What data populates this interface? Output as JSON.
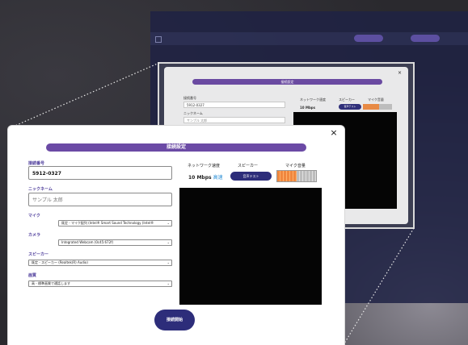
{
  "zoom_dialog": {
    "title": "接続設定",
    "close": "×",
    "field1_label": "接続番号",
    "field1_value": "5912-0327",
    "field2_label": "ニックネーム",
    "field2_value": "サンプル 太郎",
    "network_label": "ネットワーク速度",
    "network_value": "10 Mbps",
    "speaker_label": "スピーカー",
    "speaker_button": "音声テスト",
    "mic_label": "マイク音量"
  },
  "dialog": {
    "title": "接続設定",
    "close_label": "×",
    "connection_number": {
      "label": "接続番号",
      "value": "5912-0327"
    },
    "nickname": {
      "label": "ニックネーム",
      "placeholder": "サンプル 太郎"
    },
    "mic": {
      "label": "マイク",
      "selected": "既定 - マイク配列 (Intel® Smart Sound Technology (Intel®"
    },
    "camera": {
      "label": "カメラ",
      "selected": "Integrated Webcam (0c45:672f)"
    },
    "speaker": {
      "label": "スピーカー",
      "selected": "既定 - スピーカー (Realtek(R) Audio)"
    },
    "quality": {
      "label": "画質",
      "selected": "高 - 標準画質で通話します"
    },
    "network": {
      "label": "ネットワーク速度",
      "value": "10 Mbps",
      "status": "高速"
    },
    "speaker_test": {
      "label": "スピーカー",
      "button": "音声テスト"
    },
    "mic_level": {
      "label": "マイク音量",
      "level": 0.5
    },
    "start_button": "接続開始"
  },
  "colors": {
    "accent_purple": "#6b4aa5",
    "button_navy": "#2d2d7a",
    "meter_orange": "#f0873e",
    "fast_blue": "#2b8fd6"
  }
}
